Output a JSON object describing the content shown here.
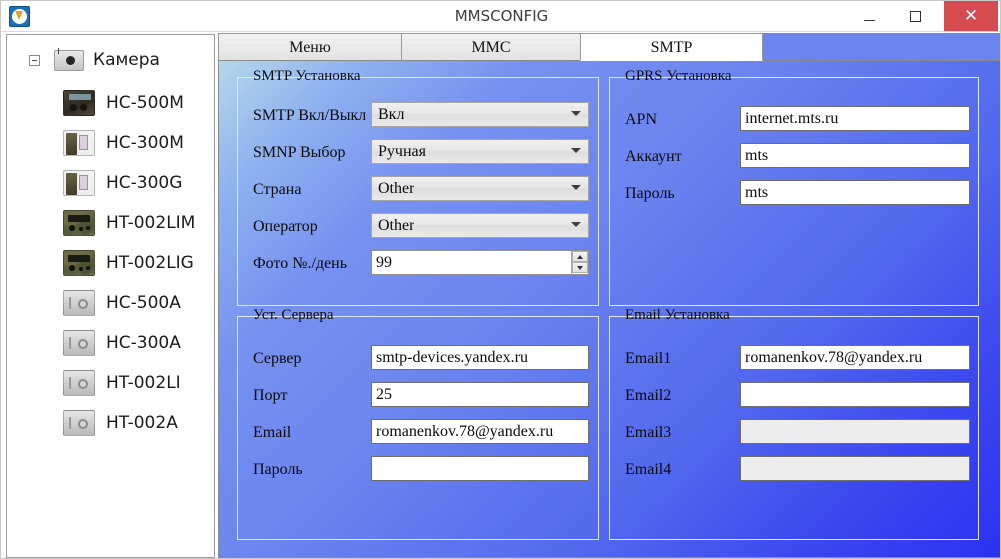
{
  "window": {
    "title": "MMSCONFIG",
    "app_icon": "app-icon",
    "minimize_label": "–",
    "maximize_label": "□",
    "close_label": "✕"
  },
  "sidebar": {
    "root": {
      "label": "Камера",
      "icon": "camera-icon",
      "expanded": true
    },
    "items": [
      {
        "label": "HC-500M",
        "icon": "trailcam-darkbox-icon"
      },
      {
        "label": "HC-300M",
        "icon": "trailcam-handheld-icon"
      },
      {
        "label": "HC-300G",
        "icon": "trailcam-handheld-icon"
      },
      {
        "label": "HT-002LIM",
        "icon": "trailcam-camo-icon"
      },
      {
        "label": "HT-002LIG",
        "icon": "trailcam-camo-icon"
      },
      {
        "label": "HC-500A",
        "icon": "camera-grey-icon"
      },
      {
        "label": "HC-300A",
        "icon": "camera-grey-icon"
      },
      {
        "label": "HT-002LI",
        "icon": "camera-grey-icon"
      },
      {
        "label": "HT-002A",
        "icon": "camera-grey-icon"
      }
    ]
  },
  "tabs": [
    {
      "label": "Меню",
      "active": false
    },
    {
      "label": "MMC",
      "active": false
    },
    {
      "label": "SMTP",
      "active": true
    }
  ],
  "groups": {
    "smtp": {
      "legend": "SMTP Установка",
      "fields": [
        {
          "label": "SMTP Вкл/Выкл",
          "value": "Вкл",
          "type": "combo"
        },
        {
          "label": "SMNP Выбор",
          "value": "Ручная",
          "type": "combo"
        },
        {
          "label": "Страна",
          "value": "Other",
          "type": "combo"
        },
        {
          "label": "Оператор",
          "value": "Other",
          "type": "combo"
        },
        {
          "label": "Фото №./день",
          "value": "99",
          "type": "spinner"
        }
      ]
    },
    "gprs": {
      "legend": "GPRS Установка",
      "fields": [
        {
          "label": "APN",
          "value": "internet.mts.ru",
          "type": "text",
          "disabled": false
        },
        {
          "label": "Аккаунт",
          "value": "mts",
          "type": "text",
          "disabled": false
        },
        {
          "label": "Пароль",
          "value": "mts",
          "type": "text",
          "disabled": false
        }
      ]
    },
    "server": {
      "legend": "Уст. Сервера",
      "fields": [
        {
          "label": "Сервер",
          "value": "smtp-devices.yandex.ru",
          "type": "text",
          "disabled": false
        },
        {
          "label": "Порт",
          "value": "25",
          "type": "text",
          "disabled": false
        },
        {
          "label": "Email",
          "value": "romanenkov.78@yandex.ru",
          "type": "text",
          "disabled": false
        },
        {
          "label": "Пароль",
          "value": "",
          "type": "text",
          "disabled": false,
          "focused": true
        }
      ]
    },
    "email": {
      "legend": "Email Установка",
      "fields": [
        {
          "label": "Email1",
          "value": "romanenkov.78@yandex.ru",
          "type": "text",
          "disabled": false
        },
        {
          "label": "Email2",
          "value": "",
          "type": "text",
          "disabled": false
        },
        {
          "label": "Email3",
          "value": "",
          "type": "text",
          "disabled": true
        },
        {
          "label": "Email4",
          "value": "",
          "type": "text",
          "disabled": true
        }
      ]
    }
  },
  "colors": {
    "page_gradient_start": "#b6d7ea",
    "page_gradient_end": "#2b32f0",
    "tabstrip": "#6c84ef",
    "close_button": "#d64b51",
    "group_border": "#dfe6f5"
  }
}
